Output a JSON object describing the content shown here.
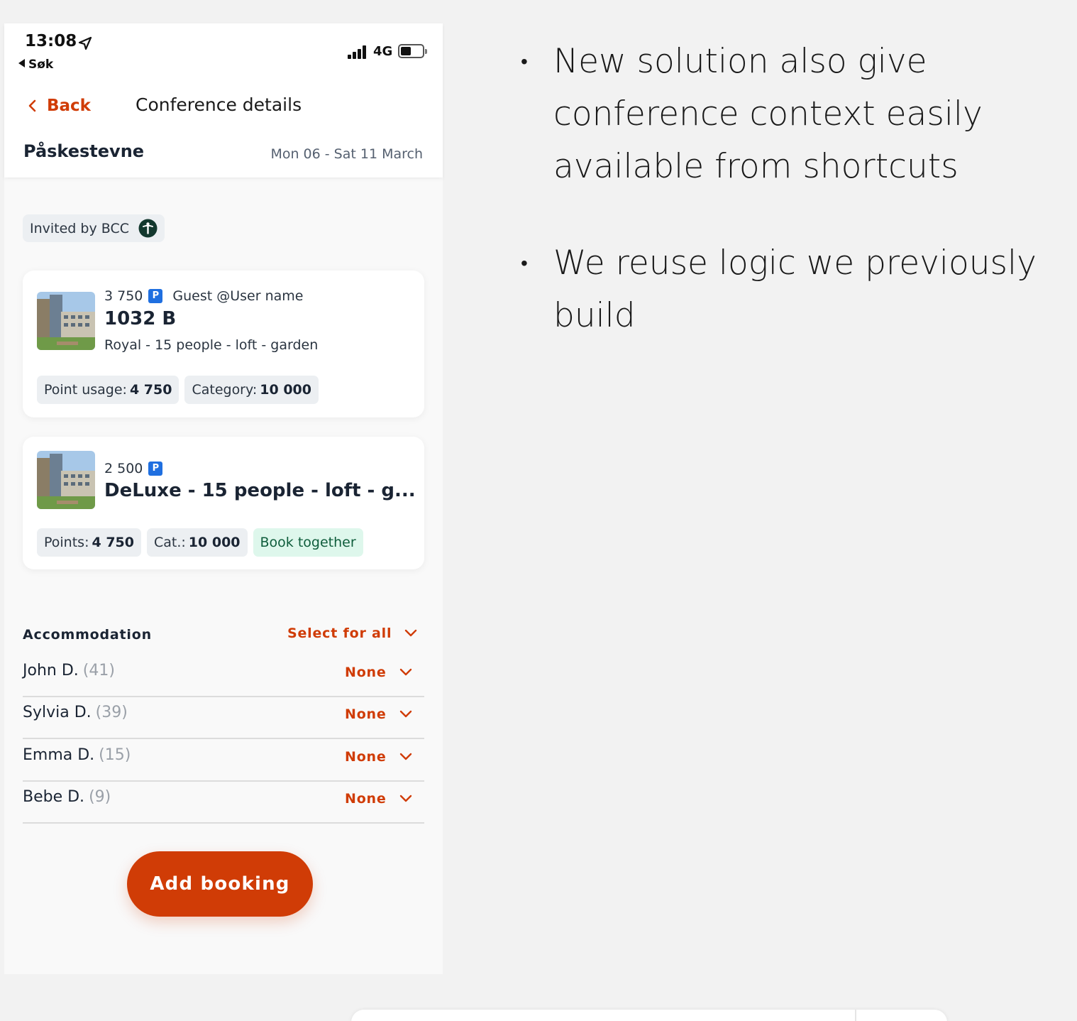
{
  "status_bar": {
    "time": "13:08",
    "back_app": "Søk",
    "network": "4G",
    "location_icon": "location-arrow-icon",
    "signal_icon": "signal-icon",
    "battery_icon": "battery-icon"
  },
  "nav": {
    "back_label": "Back",
    "title": "Conference details"
  },
  "conference": {
    "name": "Påskestevne",
    "dates": "Mon 06 - Sat 11 March",
    "invited_by": "Invited by BCC"
  },
  "rooms": [
    {
      "price": "3 750",
      "parking": "P",
      "guest": "Guest @User name",
      "name": "1032 B",
      "description": "Royal - 15 people - loft - garden",
      "chips": [
        {
          "label": "Point usage:",
          "value": "4 750"
        },
        {
          "label": "Category:",
          "value": "10 000"
        }
      ]
    },
    {
      "price": "2 500",
      "parking": "P",
      "name": "DeLuxe - 15 people - loft - g...",
      "chips": [
        {
          "label": "Points:",
          "value": "4 750"
        },
        {
          "label": "Cat.:",
          "value": "10 000"
        }
      ],
      "tag": "Book together"
    }
  ],
  "accommodation": {
    "heading": "Accommodation",
    "select_all": "Select for all",
    "people": [
      {
        "name": "John D.",
        "age": "(41)",
        "selection": "None"
      },
      {
        "name": "Sylvia D.",
        "age": "(39)",
        "selection": "None"
      },
      {
        "name": "Emma D.",
        "age": "(15)",
        "selection": "None"
      },
      {
        "name": "Bebe D.",
        "age": "(9)",
        "selection": "None"
      }
    ]
  },
  "add_booking_label": "Add booking",
  "notes": [
    "New solution also give conference context easily available from shortcuts",
    "We reuse logic we previously build"
  ],
  "colors": {
    "accent": "#d03c06",
    "parking": "#1f6fe0",
    "tag_bg": "#def7ec",
    "tag_text": "#0f5d3c"
  }
}
